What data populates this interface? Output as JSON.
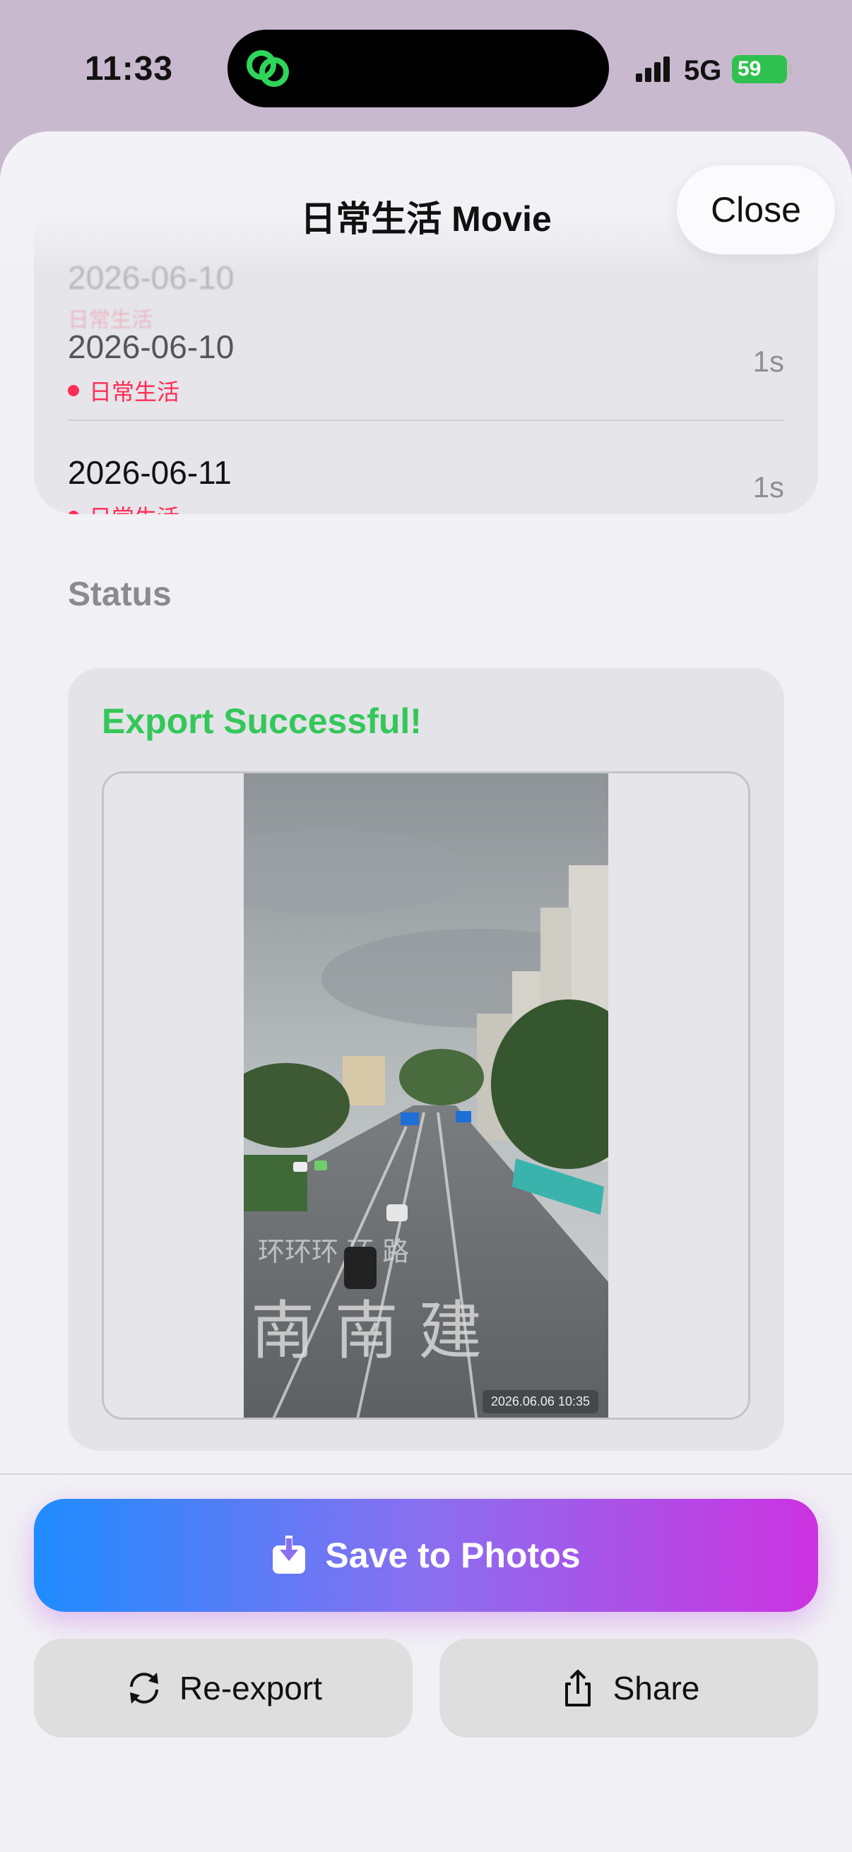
{
  "status_bar": {
    "time": "11:33",
    "network": "5G",
    "battery": "59"
  },
  "sheet": {
    "title": "日常生活 Movie",
    "close_label": "Close",
    "ghost_clip": {
      "date": "2026-06-10",
      "tag": "日常生活"
    },
    "clips": [
      {
        "date": "2026-06-10",
        "tag": "日常生活",
        "duration": "1s"
      },
      {
        "date": "2026-06-11",
        "tag": "日常生活",
        "duration": "1s"
      }
    ],
    "section_label": "Status",
    "status": {
      "title": "Export Successful!",
      "video_timestamp": "2026.06.06 10:35"
    }
  },
  "actions": {
    "save_label": "Save to Photos",
    "reexport_label": "Re-export",
    "share_label": "Share"
  },
  "colors": {
    "success": "#34c759",
    "tag": "#ff2d55",
    "gradient_start": "#1e8cff",
    "gradient_end": "#cc33e0"
  },
  "icons": [
    "app-link-icon",
    "signal-icon",
    "save-download-icon",
    "refresh-icon",
    "share-icon"
  ]
}
